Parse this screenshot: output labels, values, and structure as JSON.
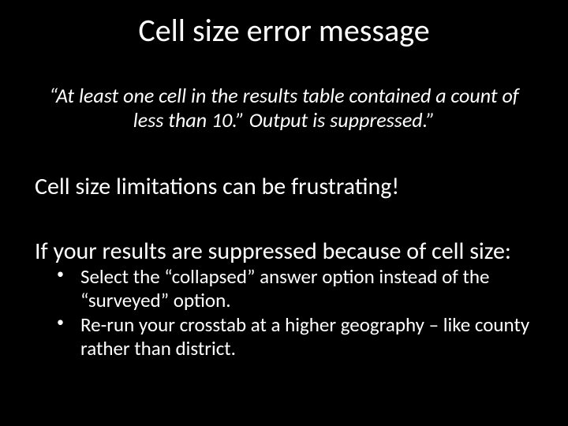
{
  "slide": {
    "title": "Cell size error message",
    "quote": "“At least one cell in the results table contained a count of less than 10.” Output is suppressed.”",
    "line_frustrating": "Cell size limitations can be frustrating!",
    "line_if": "If your results are suppressed because of cell size:",
    "bullets": [
      "Select the “collapsed” answer option instead of the “surveyed” option.",
      "Re-run your crosstab at a higher geography – like county rather than district."
    ]
  }
}
